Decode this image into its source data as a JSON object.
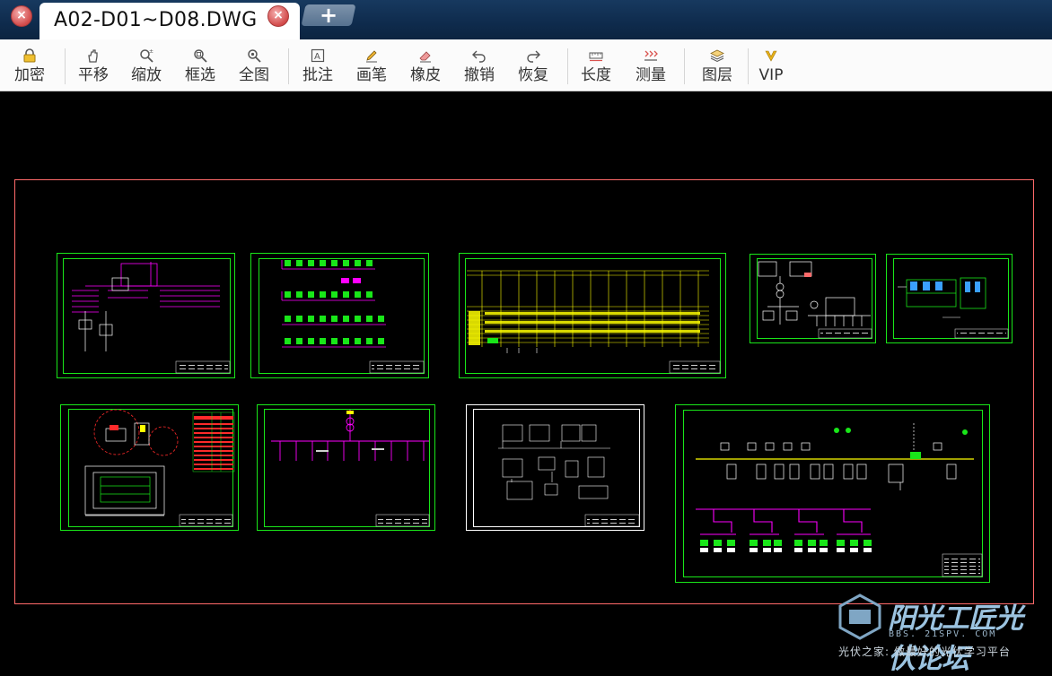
{
  "tabs": {
    "active_title": "A02-D01~D08.DWG",
    "new_tab_symbol": "+"
  },
  "toolbar": {
    "items": [
      {
        "label": "加密",
        "icon": "lock-icon"
      },
      {
        "label": "平移",
        "icon": "pan-hand-icon"
      },
      {
        "label": "缩放",
        "icon": "zoom-icon"
      },
      {
        "label": "框选",
        "icon": "zoom-window-icon"
      },
      {
        "label": "全图",
        "icon": "zoom-extents-icon"
      },
      {
        "label": "批注",
        "icon": "annotation-icon"
      },
      {
        "label": "画笔",
        "icon": "pencil-icon"
      },
      {
        "label": "橡皮",
        "icon": "eraser-icon"
      },
      {
        "label": "撤销",
        "icon": "undo-icon"
      },
      {
        "label": "恢复",
        "icon": "redo-icon"
      },
      {
        "label": "长度",
        "icon": "ruler-icon"
      },
      {
        "label": "测量",
        "icon": "measure-icon"
      },
      {
        "label": "图层",
        "icon": "layers-icon"
      },
      {
        "label": "VIP",
        "icon": "vip-icon"
      }
    ]
  },
  "colors": {
    "frame_green": "#19e619",
    "frame_white": "#ffffff",
    "cad_yellow": "#ffff00",
    "cad_magenta": "#ff00ff",
    "border_red": "#ff6a6a",
    "canvas_bg": "#000000"
  },
  "watermark": {
    "title": "阳光工匠光伏论坛",
    "url": "BBS. 21SPV. COM",
    "slogan": "光伏之家: 做最好的光伏学习平台"
  }
}
